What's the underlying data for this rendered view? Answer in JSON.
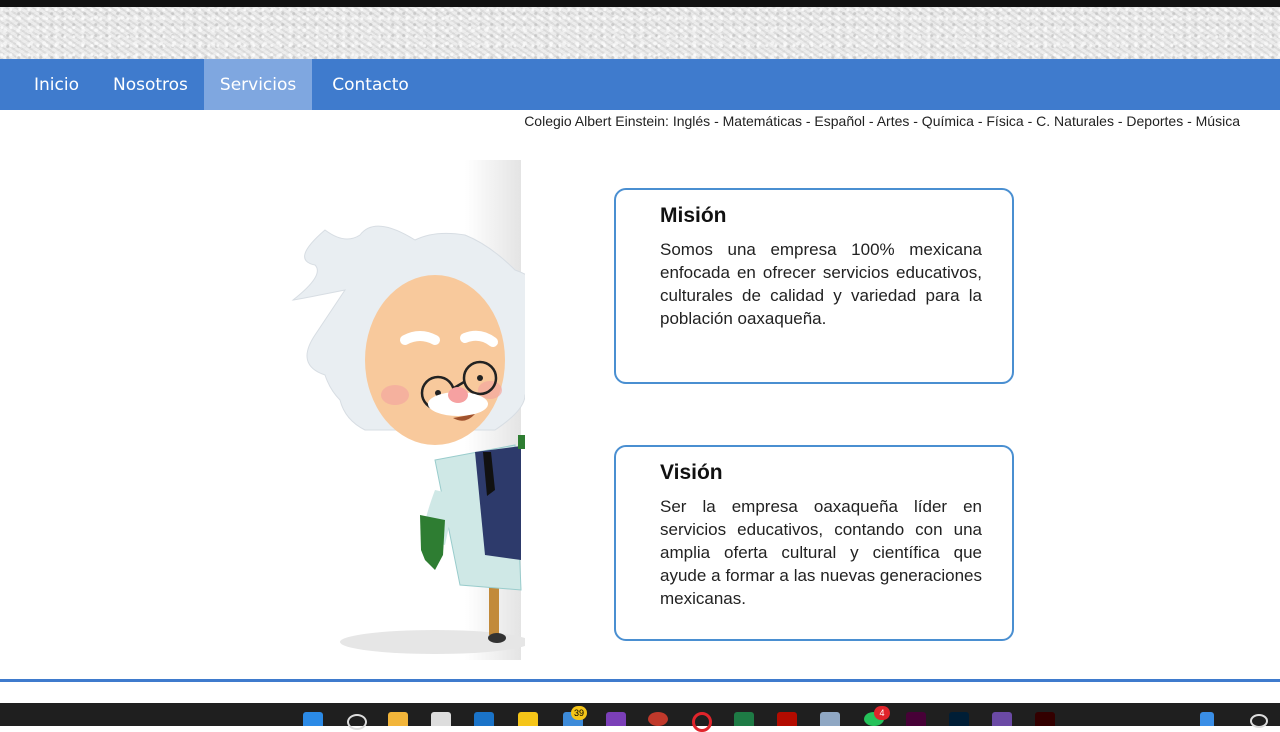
{
  "nav": {
    "items": [
      {
        "label": "Inicio"
      },
      {
        "label": "Nosotros"
      },
      {
        "label": "Servicios"
      },
      {
        "label": "Contacto"
      }
    ],
    "active": "Servicios"
  },
  "marquee_text": "Colegio Albert Einstein: Inglés - Matemáticas - Español - Artes - Química - Física - C. Naturales - Deportes - Música",
  "mision": {
    "title": "Misión",
    "text": "Somos una empresa 100% mexicana enfocada en ofrecer servicios educativos, culturales de calidad y variedad para la población oaxaqueña."
  },
  "vision": {
    "title": "Visión",
    "text": "Ser la empresa oaxaqueña líder en servicios educativos, contando con una amplia oferta cultural y científica que ayude a formar a las nuevas generaciones mexicanas."
  },
  "colors": {
    "nav_bg": "#3f7bcd",
    "nav_active": "#7fa7e0",
    "card_border": "#4a8fd1"
  },
  "taskbar": {
    "badges": [
      "39",
      "4"
    ],
    "icons": [
      "windows-start-icon",
      "search-icon",
      "file-explorer-icon",
      "store-icon",
      "outlook-icon",
      "sticky-notes-icon",
      "files-icon",
      "onenote-icon",
      "browser-icon",
      "opera-icon",
      "excel-icon",
      "acrobat-icon",
      "calculator-icon",
      "whatsapp-icon",
      "dreamweaver-icon",
      "photoshop-icon",
      "media-icon",
      "illustrator-icon"
    ]
  }
}
